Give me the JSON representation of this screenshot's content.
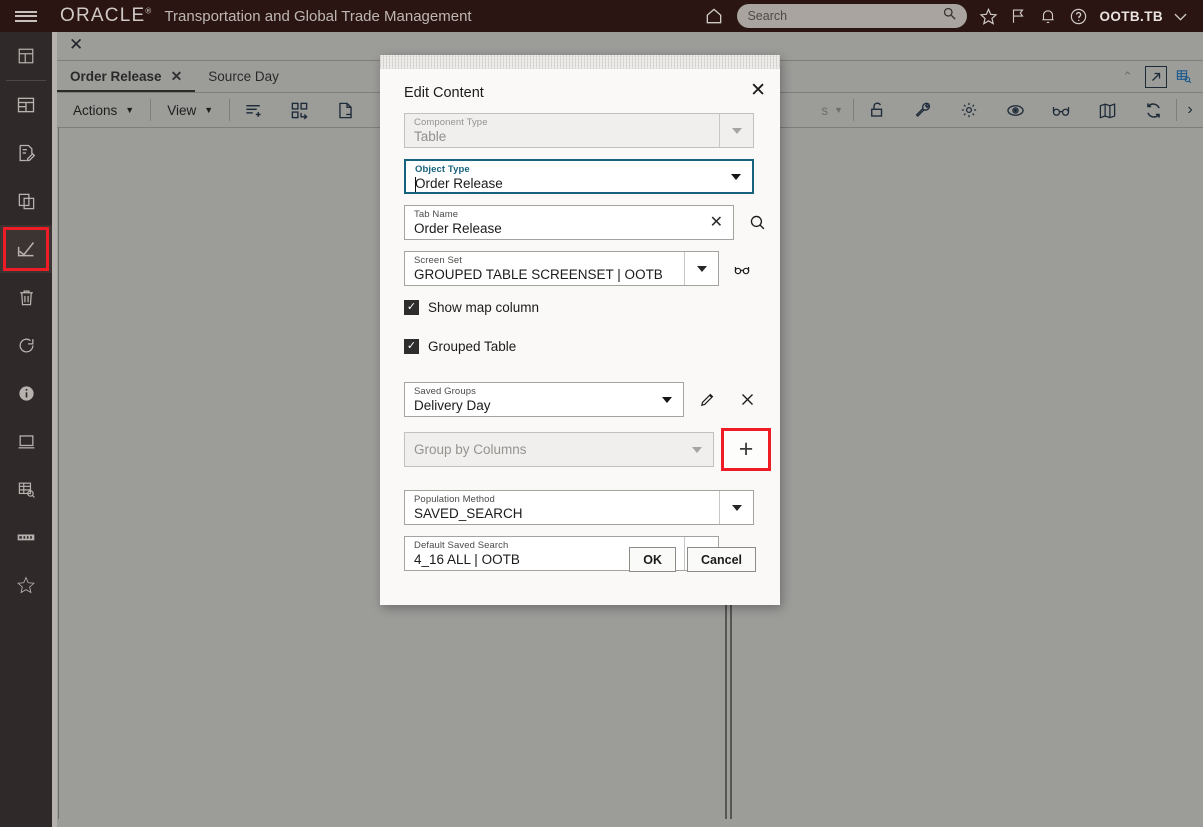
{
  "topbar": {
    "menu_icon": "hamburger-icon",
    "brand": "ORACLE",
    "brand_mark": "®",
    "app_title": "Transportation and Global Trade Management",
    "home_icon": "home-icon",
    "search_placeholder": "Search",
    "search_value": "",
    "search_icon": "search-icon",
    "favorites_icon": "star-icon",
    "flag_icon": "flag-icon",
    "notifications_icon": "bell-icon",
    "help_icon": "help-circle-icon",
    "user": "OOTB.TB",
    "user_caret_icon": "chevron-down-icon"
  },
  "sidebar": {
    "items": [
      {
        "name": "sidebar-item-dashboard",
        "icon": "grid-dashboard-icon",
        "highlighted": false
      },
      {
        "name": "sidebar-item-layout",
        "icon": "layout-panels-icon",
        "highlighted": false
      },
      {
        "name": "sidebar-item-edit-report",
        "icon": "report-edit-icon",
        "highlighted": false
      },
      {
        "name": "sidebar-item-copy",
        "icon": "copy-icon",
        "highlighted": false
      },
      {
        "name": "sidebar-item-trend-chart",
        "icon": "trend-check-chart-icon",
        "highlighted": true
      },
      {
        "name": "sidebar-item-delete",
        "icon": "trash-icon",
        "highlighted": false
      },
      {
        "name": "sidebar-item-refresh",
        "icon": "refresh-icon",
        "highlighted": false
      },
      {
        "name": "sidebar-item-info",
        "icon": "info-circle-icon",
        "highlighted": false
      },
      {
        "name": "sidebar-item-display",
        "icon": "monitor-icon",
        "highlighted": false
      },
      {
        "name": "sidebar-item-table-search",
        "icon": "table-search-icon",
        "highlighted": false
      },
      {
        "name": "sidebar-item-keyboard",
        "icon": "keyboard-icon",
        "highlighted": false
      },
      {
        "name": "sidebar-item-favorites",
        "icon": "star-filled-icon",
        "highlighted": false
      }
    ]
  },
  "workspace": {
    "close_icon": "close-icon",
    "tabs": [
      {
        "label": "Order Release",
        "active": true,
        "closable": true
      },
      {
        "label": "Source Day",
        "active": false,
        "closable": false
      }
    ],
    "tab_close_icon": "close-icon",
    "collapse_icon": "chevron-up-icon",
    "popout_icon": "open-in-new-icon",
    "grid_search_icon": "table-search-icon"
  },
  "toolbar": {
    "actions_label": "Actions",
    "view_label": "View",
    "caret_icon": "chevron-down-icon",
    "icons": [
      {
        "name": "add-row-icon",
        "glyph": "list-plus-icon"
      },
      {
        "name": "reorder-columns-icon",
        "glyph": "blocks-swap-icon"
      },
      {
        "name": "detach-page-icon",
        "glyph": "page-minus-icon"
      }
    ],
    "right_partial_label": "s",
    "right_icons": [
      {
        "name": "unlock-icon",
        "glyph": "padlock-open-icon"
      },
      {
        "name": "tools-icon",
        "glyph": "wrench-icon"
      },
      {
        "name": "settings-icon",
        "glyph": "gear-icon"
      },
      {
        "name": "visibility-icon",
        "glyph": "eye-icon"
      },
      {
        "name": "preview-icon",
        "glyph": "glasses-icon"
      },
      {
        "name": "map-icon",
        "glyph": "map-fold-icon"
      },
      {
        "name": "refresh-icon",
        "glyph": "refresh-cycle-icon"
      }
    ],
    "expand_icon": "chevron-right-icon"
  },
  "dialog": {
    "title": "Edit Content",
    "close_icon": "close-icon",
    "fields": {
      "component_type": {
        "label": "Component Type",
        "value": "Table",
        "disabled": true,
        "dropdown_icon": "chevron-down-icon"
      },
      "object_type": {
        "label": "Object Type",
        "value": "Order Release",
        "focused": true,
        "dropdown_icon": "chevron-down-icon"
      },
      "tab_name": {
        "label": "Tab Name",
        "value": "Order Release",
        "clear_icon": "close-icon",
        "search_icon": "search-icon"
      },
      "screen_set": {
        "label": "Screen Set",
        "value": "GROUPED TABLE SCREENSET | OOTB",
        "dropdown_icon": "chevron-down-icon",
        "side_icon": "glasses-icon"
      },
      "saved_groups": {
        "label": "Saved Groups",
        "value": "Delivery Day",
        "dropdown_icon": "chevron-down-icon",
        "edit_icon": "pencil-icon",
        "remove_icon": "close-icon"
      },
      "group_by_columns": {
        "label": "Group by Columns",
        "value": "",
        "disabled": true,
        "dropdown_icon": "chevron-down-icon",
        "add_icon": "plus-icon",
        "add_highlighted": true
      },
      "population_method": {
        "label": "Population Method",
        "value": "SAVED_SEARCH",
        "dropdown_icon": "chevron-down-icon"
      },
      "default_saved_search": {
        "label": "Default Saved Search",
        "value": "4_16 ALL | OOTB",
        "dropdown_icon": "chevron-down-icon",
        "side_icon": "glasses-icon"
      }
    },
    "checkboxes": [
      {
        "label": "Show map column",
        "checked": true,
        "name": "show-map-column-checkbox"
      },
      {
        "label": "Grouped Table",
        "checked": true,
        "name": "grouped-table-checkbox"
      }
    ],
    "buttons": {
      "ok": "OK",
      "cancel": "Cancel"
    }
  },
  "colors": {
    "brand_bar": "#2b1512",
    "rail": "#30292a",
    "canvas": "#9c9c99",
    "dialog_bg": "#faf9f7",
    "focus_border": "#17627e",
    "highlight_red": "#ee1c24"
  }
}
